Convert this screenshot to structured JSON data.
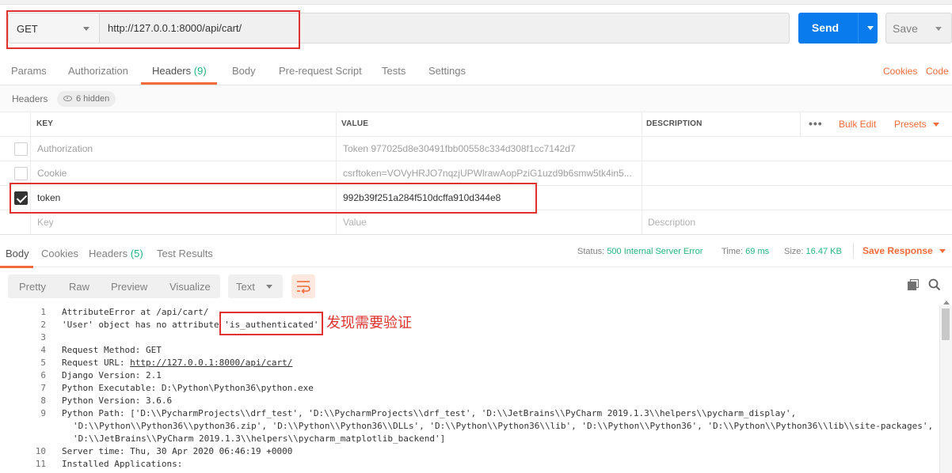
{
  "request": {
    "method": "GET",
    "url": "http://127.0.0.1:8000/api/cart/",
    "send_label": "Send",
    "save_label": "Save"
  },
  "request_tabs": {
    "params": "Params",
    "authorization": "Authorization",
    "headers": "Headers",
    "headers_count": "(9)",
    "body": "Body",
    "pre_request": "Pre-request Script",
    "tests": "Tests",
    "settings": "Settings",
    "cookies": "Cookies",
    "code": "Code"
  },
  "headers_section": {
    "label": "Headers",
    "hidden_badge": "6 hidden",
    "columns": {
      "key": "KEY",
      "value": "VALUE",
      "description": "DESCRIPTION"
    },
    "bulk_edit": "Bulk Edit",
    "presets": "Presets",
    "rows": [
      {
        "checked": false,
        "key": "Authorization",
        "value": "Token 977025d8e30491fbb00558c334d308f1cc7142d7"
      },
      {
        "checked": false,
        "key": "Cookie",
        "value": "csrftoken=VOVyHRJO7nqzjUPWlrawAopPziG1uzd9b6smw5tk4in5..."
      },
      {
        "checked": true,
        "key": "token",
        "value": "992b39f251a284f510dcffa910d344e8"
      }
    ],
    "new_row": {
      "key_placeholder": "Key",
      "value_placeholder": "Value",
      "description_placeholder": "Description"
    }
  },
  "response_tabs": {
    "body": "Body",
    "cookies": "Cookies",
    "headers": "Headers",
    "headers_count": "(5)",
    "test_results": "Test Results"
  },
  "response_status": {
    "status_label": "Status:",
    "status_value": "500 Internal Server Error",
    "time_label": "Time:",
    "time_value": "69 ms",
    "size_label": "Size:",
    "size_value": "16.47 KB",
    "save_response": "Save Response"
  },
  "view_toolbar": {
    "pretty": "Pretty",
    "raw": "Raw",
    "preview": "Preview",
    "visualize": "Visualize",
    "format": "Text"
  },
  "code_lines": [
    {
      "num": "1",
      "text": "AttributeError at /api/cart/"
    },
    {
      "num": "2",
      "text": "'User' object has no attribute 'is_authenticated'"
    },
    {
      "num": "3",
      "text": ""
    },
    {
      "num": "4",
      "text": "Request Method: GET"
    },
    {
      "num": "5",
      "text_prefix": "Request URL: ",
      "text_link": "http://127.0.0.1:8000/api/cart/"
    },
    {
      "num": "6",
      "text": "Django Version: 2.1"
    },
    {
      "num": "7",
      "text": "Python Executable: D:\\Python\\Python36\\python.exe"
    },
    {
      "num": "8",
      "text": "Python Version: 3.6.6"
    },
    {
      "num": "9",
      "text": "Python Path: ['D:\\\\PycharmProjects\\\\drf_test', 'D:\\\\PycharmProjects\\\\drf_test', 'D:\\\\JetBrains\\\\PyCharm 2019.1.3\\\\helpers\\\\pycharm_display',"
    },
    {
      "num": "",
      "text": "'D:\\\\Python\\\\Python36\\\\python36.zip', 'D:\\\\Python\\\\Python36\\\\DLLs', 'D:\\\\Python\\\\Python36\\\\lib', 'D:\\\\Python\\\\Python36', 'D:\\\\Python\\\\Python36\\\\lib\\\\site-packages',"
    },
    {
      "num": "",
      "text": "'D:\\\\JetBrains\\\\PyCharm 2019.1.3\\\\helpers\\\\pycharm_matplotlib_backend']"
    },
    {
      "num": "10",
      "text": "Server time: Thu, 30 Apr 2020 06:46:19 +0000"
    },
    {
      "num": "11",
      "text": "Installed Applications:"
    }
  ],
  "annotation": {
    "note": "发现需要验证",
    "color": "#e0332f"
  },
  "colors": {
    "accent_orange": "#f26b3a",
    "send_blue": "#097bed",
    "status_green": "#26b47f"
  }
}
